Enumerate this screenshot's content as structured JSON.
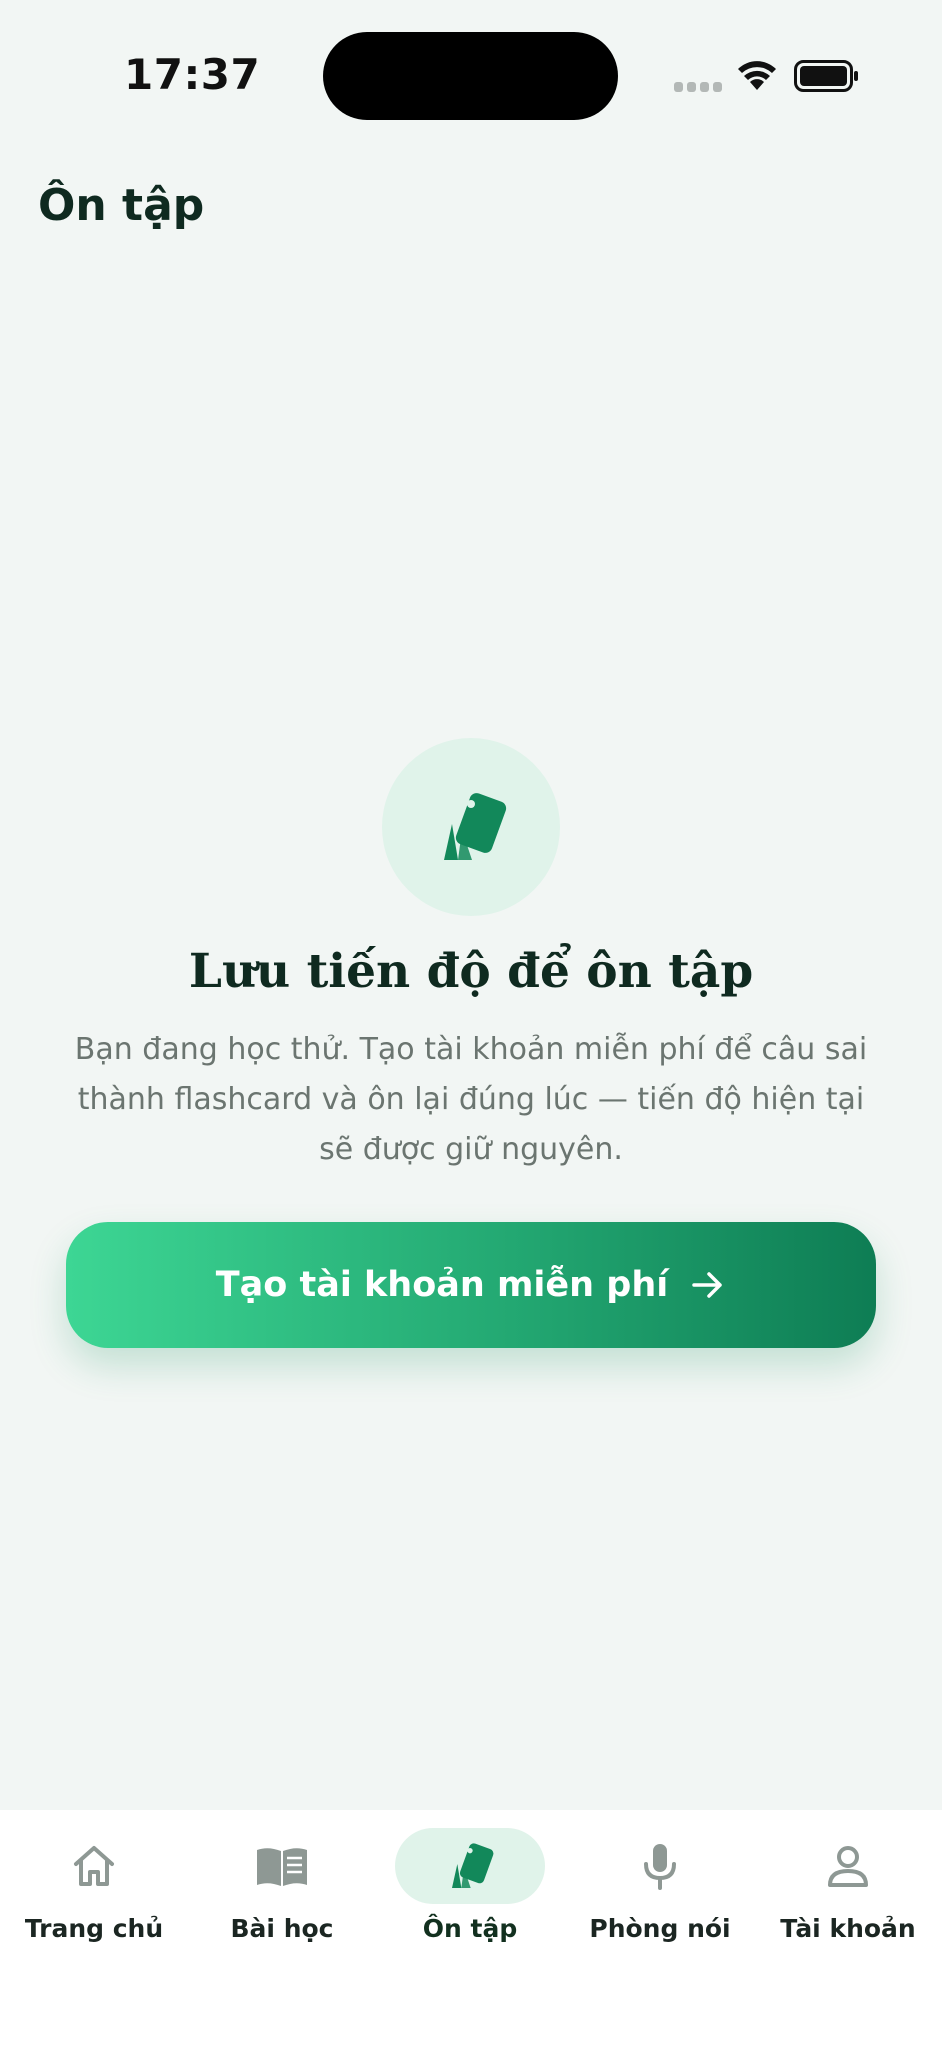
{
  "status_bar": {
    "time": "17:37"
  },
  "header": {
    "title": "Ôn tập"
  },
  "empty_state": {
    "icon": "flashcards-icon",
    "title": "Lưu tiến độ để ôn tập",
    "description": "Bạn đang học thử. Tạo tài khoản miễn phí để câu sai thành flashcard và ôn lại đúng lúc — tiến độ hiện tại sẽ được giữ nguyên.",
    "cta_label": "Tạo tài khoản miễn phí"
  },
  "tab_bar": {
    "items": [
      {
        "label": "Trang chủ",
        "icon": "home-icon",
        "active": false
      },
      {
        "label": "Bài học",
        "icon": "book-icon",
        "active": false
      },
      {
        "label": "Ôn tập",
        "icon": "flashcards-icon",
        "active": true
      },
      {
        "label": "Phòng nói",
        "icon": "microphone-icon",
        "active": false
      },
      {
        "label": "Tài khoản",
        "icon": "user-icon",
        "active": false
      }
    ]
  },
  "colors": {
    "background": "#f2f6f4",
    "brand_green": "#12885a",
    "brand_green_light": "#3dd694",
    "icon_bg": "#e0f3ea",
    "inactive_icon": "#8e9894"
  }
}
